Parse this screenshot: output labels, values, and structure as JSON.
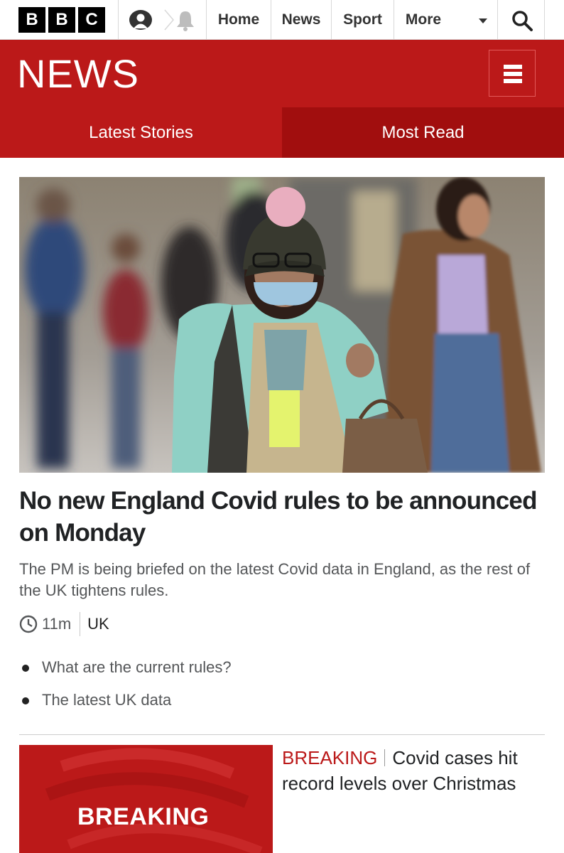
{
  "topbar": {
    "logo_letters": [
      "B",
      "B",
      "C"
    ],
    "nav": [
      {
        "label": "Home"
      },
      {
        "label": "News"
      },
      {
        "label": "Sport"
      },
      {
        "label": "More"
      }
    ],
    "icons": [
      "account-icon",
      "notification-bell-icon",
      "search-icon",
      "chevron-down-icon"
    ]
  },
  "masthead": {
    "title": "NEWS",
    "menu_icon": "hamburger-menu-icon",
    "brand_color": "#bb1919"
  },
  "tabs": [
    {
      "label": "Latest Stories",
      "active": false
    },
    {
      "label": "Most Read",
      "active": true
    }
  ],
  "lead_story": {
    "headline": "No new England Covid rules to be announced on Monday",
    "summary": "The PM is being briefed on the latest Covid data in England, as the rest of the UK tightens rules.",
    "time": "11m",
    "section": "UK",
    "related": [
      {
        "label": "What are the current rules?"
      },
      {
        "label": "The latest UK data"
      }
    ]
  },
  "second_story": {
    "image_text": "BREAKING",
    "label": "BREAKING",
    "headline": "Covid cases hit record levels over Christmas"
  }
}
